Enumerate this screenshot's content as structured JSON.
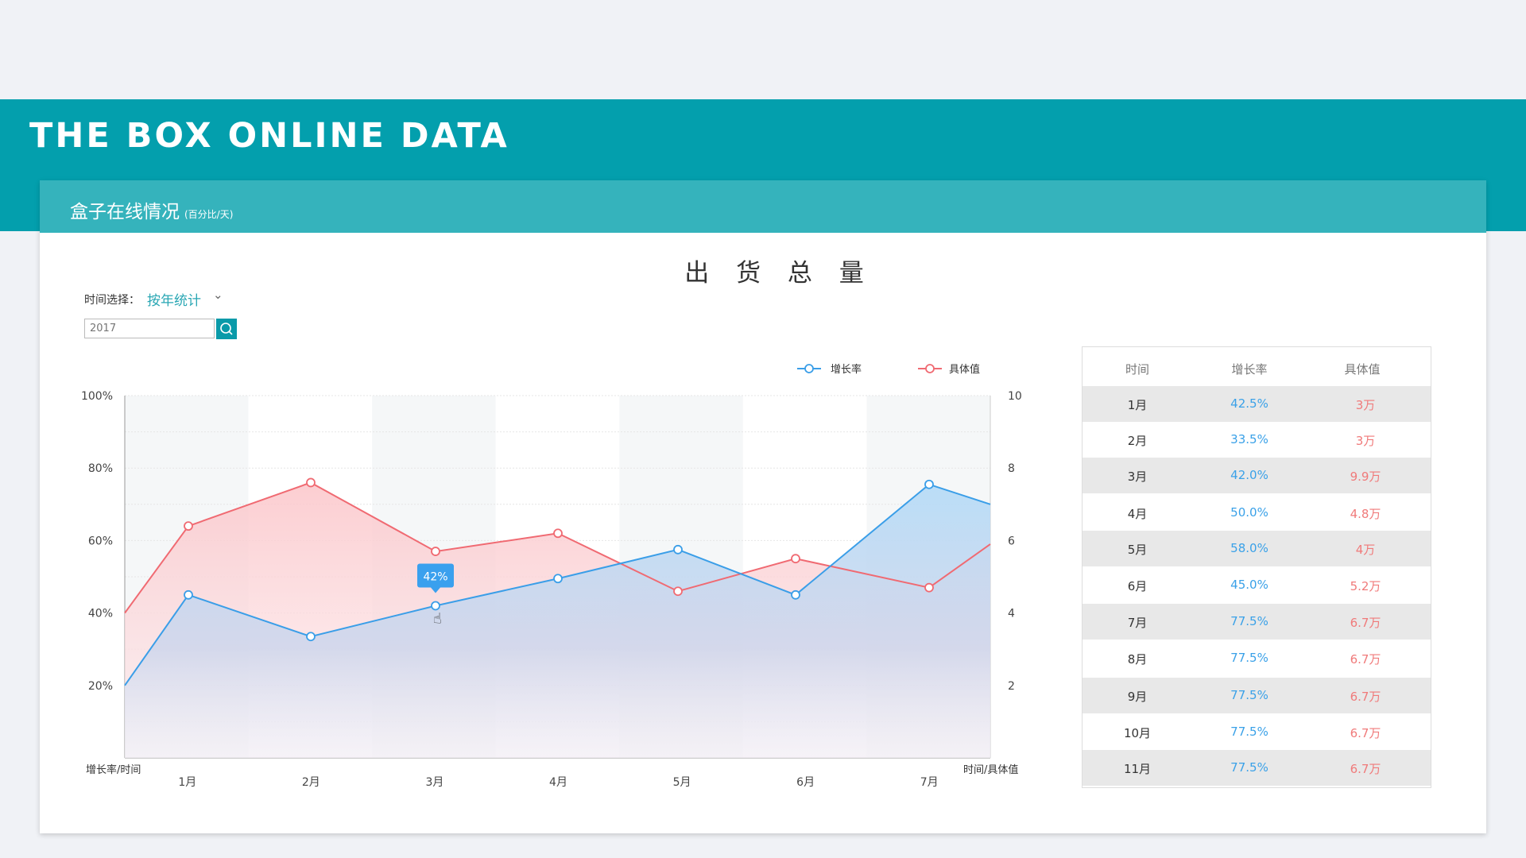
{
  "brand": "THE BOX ONLINE DATA",
  "card": {
    "title": "盒子在线情况",
    "subtitle": "(百分比/天)"
  },
  "chart_title": "出 货 总 量",
  "filter": {
    "label": "时间选择：",
    "mode": "按年统计",
    "year_placeholder": "2017"
  },
  "colors": {
    "teal": "#039fad",
    "blue": "#3a9ee8",
    "red": "#f06a72"
  },
  "chart_data": {
    "type": "line",
    "categories": [
      "1月",
      "2月",
      "3月",
      "4月",
      "5月",
      "6月",
      "7月"
    ],
    "series": [
      {
        "name": "增长率",
        "axis": "left",
        "values": [
          20,
          45,
          33.5,
          42,
          49.5,
          57.5,
          45,
          75.5,
          70
        ]
      },
      {
        "name": "具体值",
        "axis": "right",
        "values": [
          4,
          6.4,
          7.6,
          5.7,
          6.2,
          4.6,
          5.5,
          4.7,
          5.9
        ]
      }
    ],
    "y_left": {
      "label": "增长率/时间",
      "ticks": [
        "20%",
        "40%",
        "60%",
        "80%",
        "100%"
      ],
      "range": [
        0,
        100
      ]
    },
    "y_right": {
      "label": "时间/具体值",
      "ticks": [
        "2",
        "4",
        "6",
        "8",
        "10"
      ],
      "range": [
        0,
        10
      ]
    },
    "tooltip": {
      "text": "42%",
      "category": "3月"
    },
    "legend": [
      "增长率",
      "具体值"
    ]
  },
  "table": {
    "headers": [
      "时间",
      "增长率",
      "具体值"
    ],
    "rows": [
      [
        "1月",
        "42.5%",
        "3万"
      ],
      [
        "2月",
        "33.5%",
        "3万"
      ],
      [
        "3月",
        "42.0%",
        "9.9万"
      ],
      [
        "4月",
        "50.0%",
        "4.8万"
      ],
      [
        "5月",
        "58.0%",
        "4万"
      ],
      [
        "6月",
        "45.0%",
        "5.2万"
      ],
      [
        "7月",
        "77.5%",
        "6.7万"
      ],
      [
        "8月",
        "77.5%",
        "6.7万"
      ],
      [
        "9月",
        "77.5%",
        "6.7万"
      ],
      [
        "10月",
        "77.5%",
        "6.7万"
      ],
      [
        "11月",
        "77.5%",
        "6.7万"
      ]
    ]
  }
}
